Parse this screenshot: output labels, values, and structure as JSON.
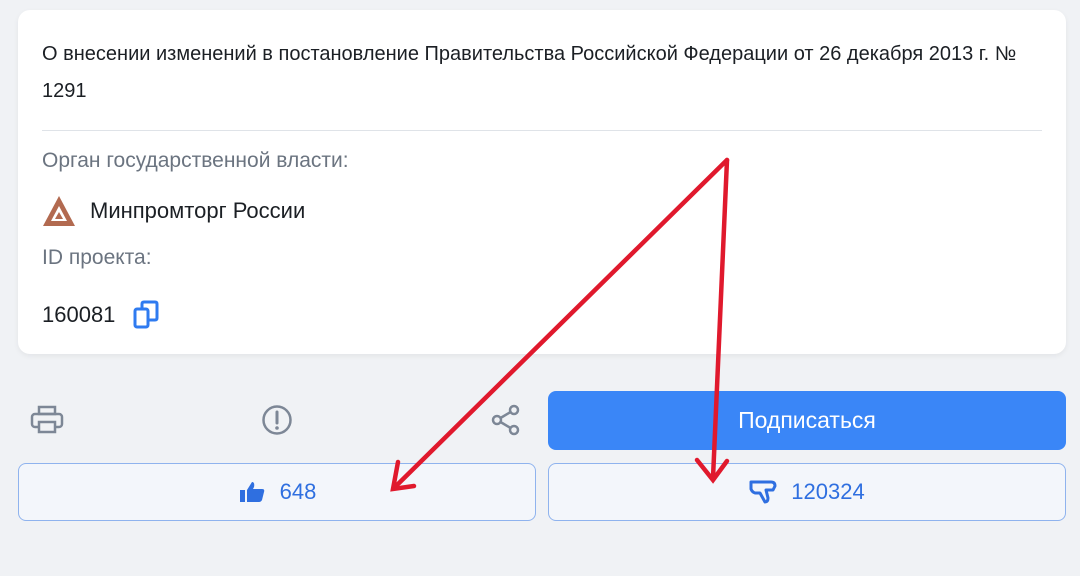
{
  "document": {
    "title": "О внесении изменений в постановление Правительства Российской Федерации от 26 декабря 2013 г. № 1291",
    "authority_label": "Орган государственной власти:",
    "authority_name": "Минпромторг России",
    "project_id_label": "ID проекта:",
    "project_id": "160081"
  },
  "actions": {
    "subscribe_label": "Подписаться",
    "likes": "648",
    "dislikes": "120324"
  },
  "icons": {
    "agency_logo": "minpromtorg-logo",
    "copy": "copy-icon",
    "print": "printer-icon",
    "report": "exclamation-circle-icon",
    "share": "share-icon",
    "like": "thumbs-up-icon",
    "dislike": "thumbs-down-icon"
  },
  "colors": {
    "accent": "#3a86f7",
    "vote_text": "#2f6fe0",
    "annotation_arrow": "#e0192d",
    "logo": "#b26a50"
  }
}
